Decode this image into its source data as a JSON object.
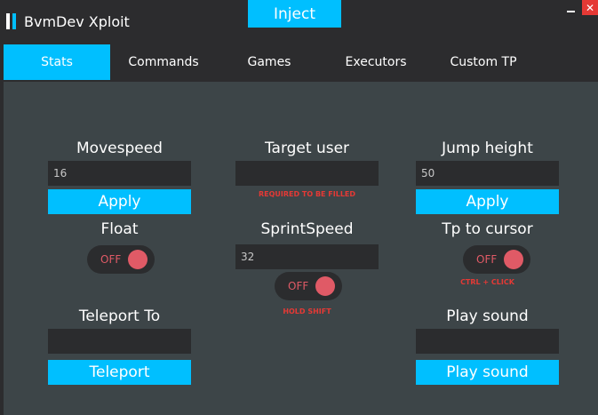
{
  "app": {
    "title": "BvmDev Xploit",
    "inject_label": "Inject",
    "close_label": "✕",
    "accent": "#00bfff"
  },
  "tabs": [
    {
      "label": "Stats",
      "active": true
    },
    {
      "label": "Commands",
      "active": false
    },
    {
      "label": "Games",
      "active": false
    },
    {
      "label": "Executors",
      "active": false
    },
    {
      "label": "Custom TP",
      "active": false
    }
  ],
  "stats": {
    "movespeed": {
      "label": "Movespeed",
      "value": "16",
      "apply_label": "Apply"
    },
    "target_user": {
      "label": "Target user",
      "value": "",
      "hint": "REQUIRED TO BE FILLED"
    },
    "jump_height": {
      "label": "Jump height",
      "value": "50",
      "apply_label": "Apply"
    },
    "float": {
      "label": "Float",
      "state": "OFF"
    },
    "sprint_speed": {
      "label": "SprintSpeed",
      "value": "32",
      "state": "OFF",
      "hint": "HOLD SHIFT"
    },
    "tp_to_cursor": {
      "label": "Tp to cursor",
      "state": "OFF",
      "hint": "CTRL + CLICK"
    },
    "teleport_to": {
      "label": "Teleport To",
      "value": "",
      "button_label": "Teleport"
    },
    "play_sound": {
      "label": "Play sound",
      "value": "",
      "button_label": "Play sound"
    }
  }
}
